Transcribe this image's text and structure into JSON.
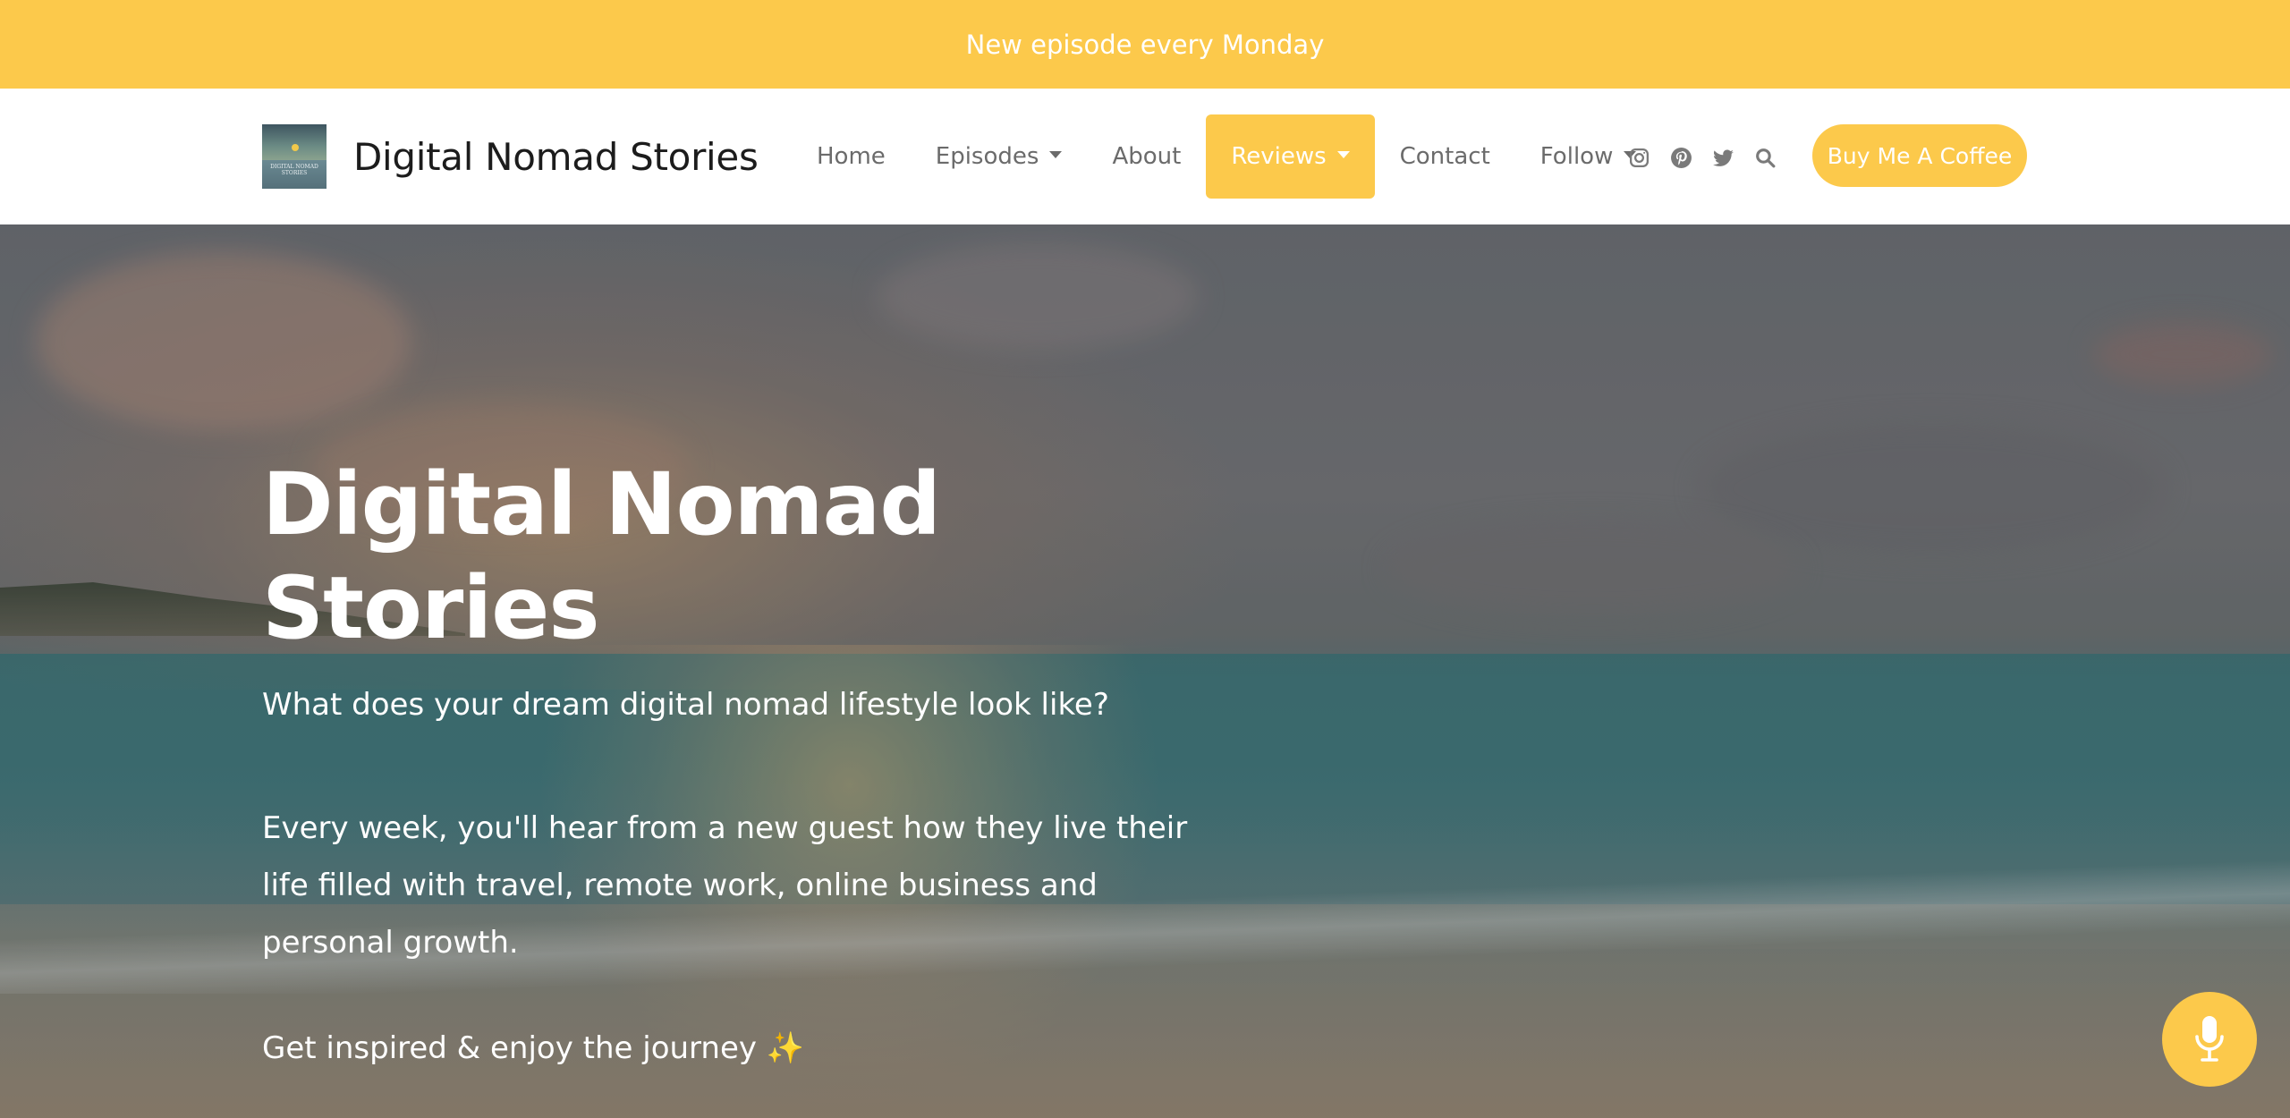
{
  "announcement": {
    "text": "New episode every Monday"
  },
  "brand": {
    "title": "Digital Nomad Stories",
    "logo_text": "DIGITAL NOMAD STORIES"
  },
  "nav": {
    "items": [
      {
        "label": "Home",
        "has_dropdown": false,
        "active": false
      },
      {
        "label": "Episodes",
        "has_dropdown": true,
        "active": false
      },
      {
        "label": "About",
        "has_dropdown": false,
        "active": false
      },
      {
        "label": "Reviews",
        "has_dropdown": true,
        "active": true
      },
      {
        "label": "Contact",
        "has_dropdown": false,
        "active": false
      },
      {
        "label": "Follow",
        "has_dropdown": true,
        "active": false
      }
    ],
    "social_icons": [
      "instagram-icon",
      "pinterest-icon",
      "twitter-icon",
      "search-icon"
    ],
    "cta_label": "Buy Me A Coffee"
  },
  "hero": {
    "title": "Digital Nomad Stories",
    "subtitle": "What does your dream digital nomad lifestyle look like?",
    "description": "Every week, you'll hear from a new guest how they live their life filled with travel, remote work, online business and personal growth.",
    "tagline": "Get inspired & enjoy the journey",
    "tagline_emoji": "✨"
  },
  "floating": {
    "icon": "microphone-icon"
  },
  "colors": {
    "accent": "#fcc94b",
    "nav_text": "#6b6b6b",
    "brand_text": "#1c1c1c"
  }
}
